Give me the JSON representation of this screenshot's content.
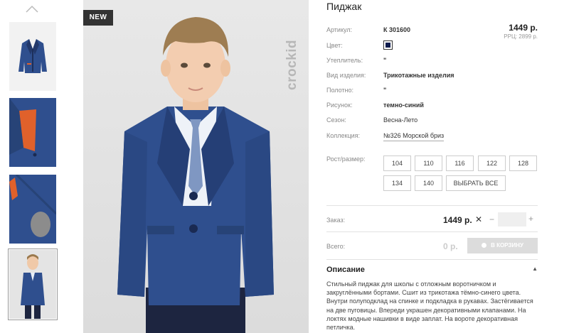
{
  "product": {
    "badge": "NEW",
    "brand": "crockid",
    "title": "Пиджак",
    "price": "1449 р.",
    "rrp": "РРЦ: 2899 р."
  },
  "attributes": [
    {
      "label": "Артикул:",
      "value": "К 301600"
    },
    {
      "label": "Цвет:",
      "value": ""
    },
    {
      "label": "Утеплитель:",
      "value": "\""
    },
    {
      "label": "Вид изделия:",
      "value": "Трикотажные изделия"
    },
    {
      "label": "Полотно:",
      "value": "\""
    },
    {
      "label": "Рисунок:",
      "value": "темно-синий"
    },
    {
      "label": "Сезон:",
      "value": "Весна-Лето"
    },
    {
      "label": "Коллекция:",
      "value": "№326 Морской бриз"
    }
  ],
  "color_swatch": "#0d1b4d",
  "sizes": {
    "label": "Рост/размер:",
    "options": [
      "104",
      "110",
      "116",
      "122",
      "128",
      "134",
      "140"
    ],
    "select_all": "ВЫБРАТЬ ВСЕ"
  },
  "order": {
    "label": "Заказ:",
    "unit_price": "1449 р.",
    "times": "✕",
    "minus": "−",
    "plus": "+",
    "quantity": ""
  },
  "total": {
    "label": "Всего:",
    "value": "0 р.",
    "cart_button": "В КОРЗИНУ"
  },
  "description": {
    "title": "Описание",
    "toggle": "▲",
    "text": "Стильный пиджак для школы с отложным воротничком и закруглёнными бортами. Сшит из трикотажа тёмно-синего цвета. Внутри полуподклад на спинке и подкладка в рукавах. Застёгивается на две пуговицы. Впереди украшен декоративными клапанами. На локтях модные нашивки в виде заплат. На вороте декоративная петличка."
  },
  "icons": {
    "thumbs_up": "chevron-up-icon",
    "cart": "cart-icon"
  },
  "colors": {
    "jacket": "#2f4f8e",
    "lining": "#e0612b",
    "badge_bg": "#333333"
  }
}
